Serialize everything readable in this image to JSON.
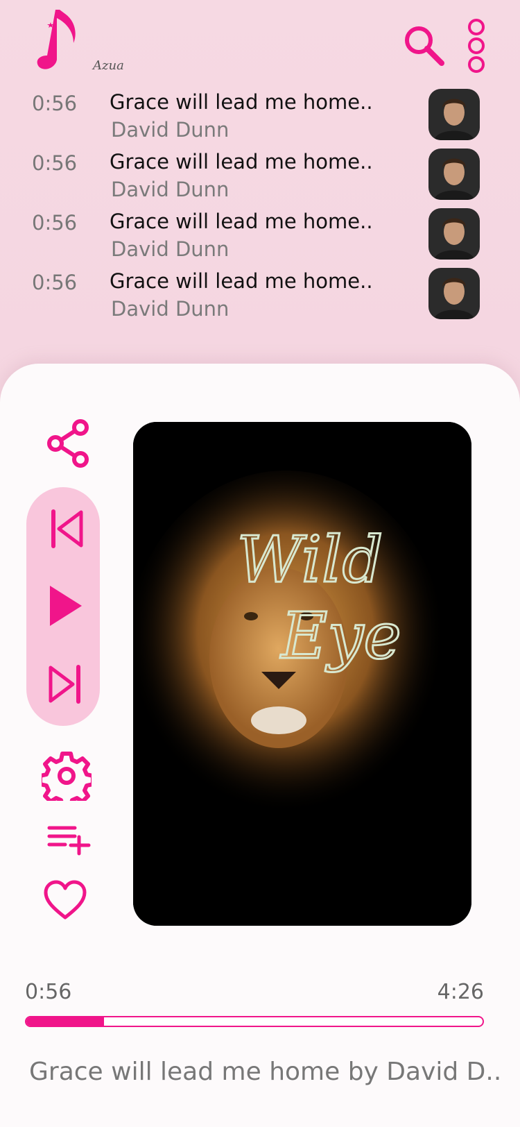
{
  "accent_color": "#f0158a",
  "header": {
    "logo_text": "Azua",
    "icons": [
      "music-note-logo-icon",
      "search-icon",
      "more-options-icon"
    ]
  },
  "tracks": [
    {
      "time": "0:56",
      "title": "Grace will lead me home..",
      "artist": "David Dunn"
    },
    {
      "time": "0:56",
      "title": "Grace will lead me home..",
      "artist": "David Dunn"
    },
    {
      "time": "0:56",
      "title": "Grace will lead me home..",
      "artist": "David Dunn"
    },
    {
      "time": "0:56",
      "title": "Grace will lead me home..",
      "artist": "David Dunn"
    }
  ],
  "player": {
    "album_art_text": "Wild Eye",
    "current_time": "0:56",
    "total_time": "4:26",
    "progress": 0.17,
    "now_playing": "Grace will lead me home by David D....",
    "side_icons": [
      "share-icon",
      "skip-previous-icon",
      "play-icon",
      "skip-next-icon",
      "settings-icon",
      "add-to-queue-icon",
      "heart-icon"
    ]
  }
}
